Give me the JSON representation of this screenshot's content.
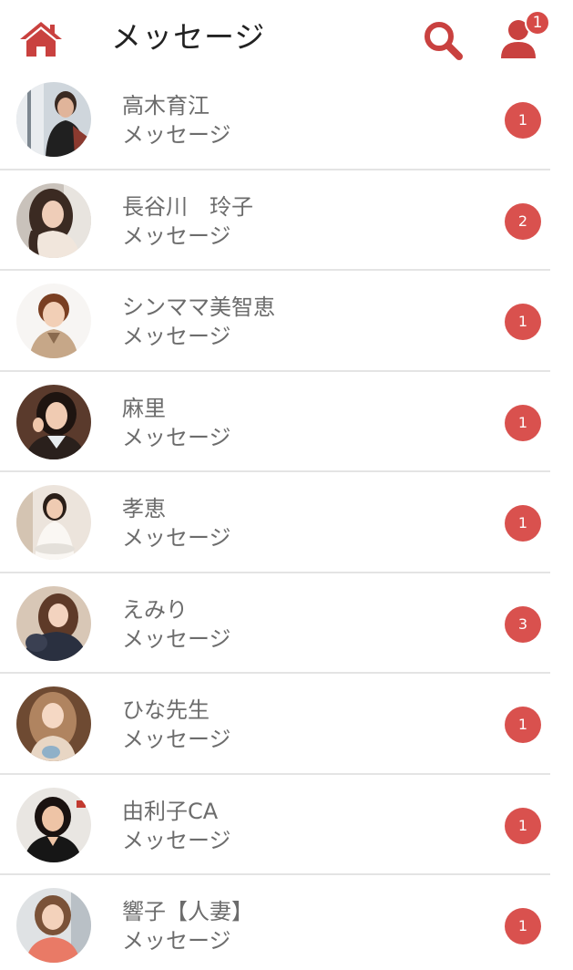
{
  "header": {
    "title": "メッセージ",
    "profile_badge": "1"
  },
  "colors": {
    "accent": "#c9413f",
    "badge": "#d9514e",
    "divider": "#e4e4e4",
    "text": "#6c6c6c"
  },
  "conversations": [
    {
      "name": "高木育江",
      "message": "メッセージ",
      "unread": "1"
    },
    {
      "name": "長谷川　玲子",
      "message": "メッセージ",
      "unread": "2"
    },
    {
      "name": "シンママ美智恵",
      "message": "メッセージ",
      "unread": "1"
    },
    {
      "name": "麻里",
      "message": "メッセージ",
      "unread": "1"
    },
    {
      "name": "孝恵",
      "message": "メッセージ",
      "unread": "1"
    },
    {
      "name": "えみり",
      "message": "メッセージ",
      "unread": "3"
    },
    {
      "name": "ひな先生",
      "message": "メッセージ",
      "unread": "1"
    },
    {
      "name": "由利子CA",
      "message": "メッセージ",
      "unread": "1"
    },
    {
      "name": "響子【人妻】",
      "message": "メッセージ",
      "unread": "1"
    }
  ]
}
